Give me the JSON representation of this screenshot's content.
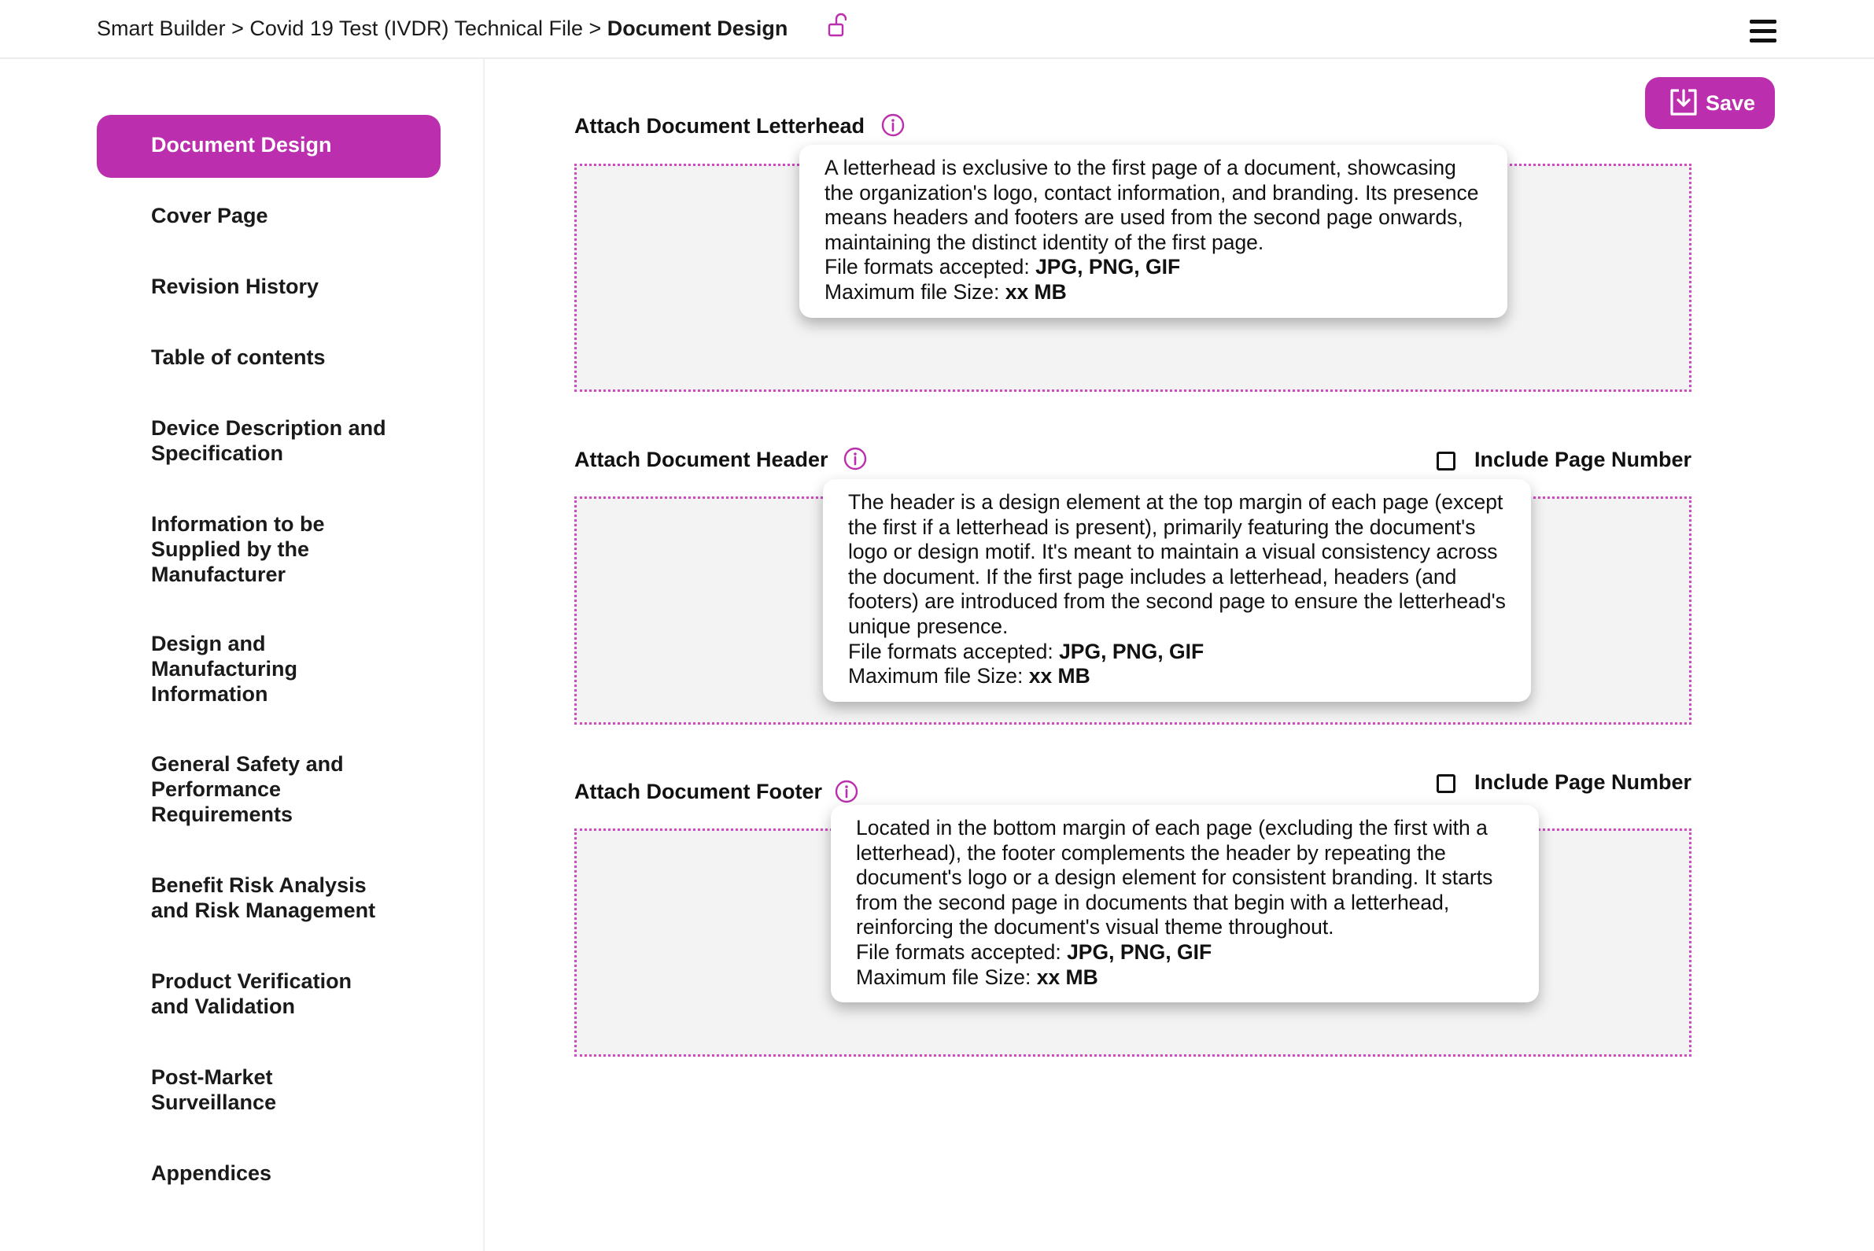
{
  "breadcrumb": {
    "root": "Smart Builder",
    "separator1": " > ",
    "file": "Covid 19 Test (IVDR) Technical File",
    "separator2": " > ",
    "current": "Document Design"
  },
  "icons": {
    "lock": "unlock-icon",
    "menu": "hamburger-menu-icon",
    "save": "save-download-icon",
    "info": "info-icon"
  },
  "colors": {
    "accent": "#bb2fae",
    "dropzone_border": "#cf4ac3",
    "dropzone_fill": "#f3f3f3"
  },
  "sidebar": {
    "items": [
      {
        "label": "Document Design",
        "active": true
      },
      {
        "label": "Cover Page"
      },
      {
        "label": "Revision History"
      },
      {
        "label": "Table of contents"
      },
      {
        "label": "Device Description and Specification"
      },
      {
        "label": "Information to be Supplied by the Manufacturer"
      },
      {
        "label": "Design and Manufacturing Information"
      },
      {
        "label": "General Safety and Performance Requirements"
      },
      {
        "label": "Benefit Risk Analysis and Risk Management"
      },
      {
        "label": "Product Verification and Validation"
      },
      {
        "label": "Post-Market Surveillance"
      },
      {
        "label": "Appendices"
      }
    ]
  },
  "toolbar": {
    "save_label": "Save"
  },
  "sections": {
    "letterhead": {
      "title": "Attach Document Letterhead",
      "tooltip": {
        "text": "A letterhead is exclusive to the first page of a document, showcasing the organization's logo, contact information, and branding. Its presence means headers and footers are used from the second page onwards, maintaining the distinct identity of the first page.",
        "formats_label": "File formats accepted: ",
        "formats_value": "JPG, PNG, GIF",
        "size_label": "Maximum file Size: ",
        "size_value": "xx MB"
      }
    },
    "header": {
      "title": "Attach Document Header",
      "checkbox_label": "Include Page Number",
      "tooltip": {
        "text": "The header is a design element at the top margin of each page (except the first if a letterhead is present), primarily featuring the document's logo or design motif. It's meant to maintain a visual consistency across the document. If the first page includes a letterhead, headers (and footers) are introduced from the second page to ensure the letterhead's unique presence.",
        "formats_label": "File formats accepted: ",
        "formats_value": "JPG, PNG, GIF",
        "size_label": "Maximum file Size: ",
        "size_value": "xx MB"
      }
    },
    "footer": {
      "title": "Attach Document Footer",
      "checkbox_label": "Include Page Number",
      "tooltip": {
        "text": "Located in the bottom margin of each page (excluding the first with a letterhead), the footer complements the header by repeating the document's logo or a design element for consistent branding. It starts from the second page in documents that begin with a letterhead, reinforcing the document's visual theme throughout.",
        "formats_label": "File formats accepted: ",
        "formats_value": "JPG, PNG, GIF",
        "size_label": "Maximum file Size: ",
        "size_value": "xx MB"
      }
    }
  }
}
